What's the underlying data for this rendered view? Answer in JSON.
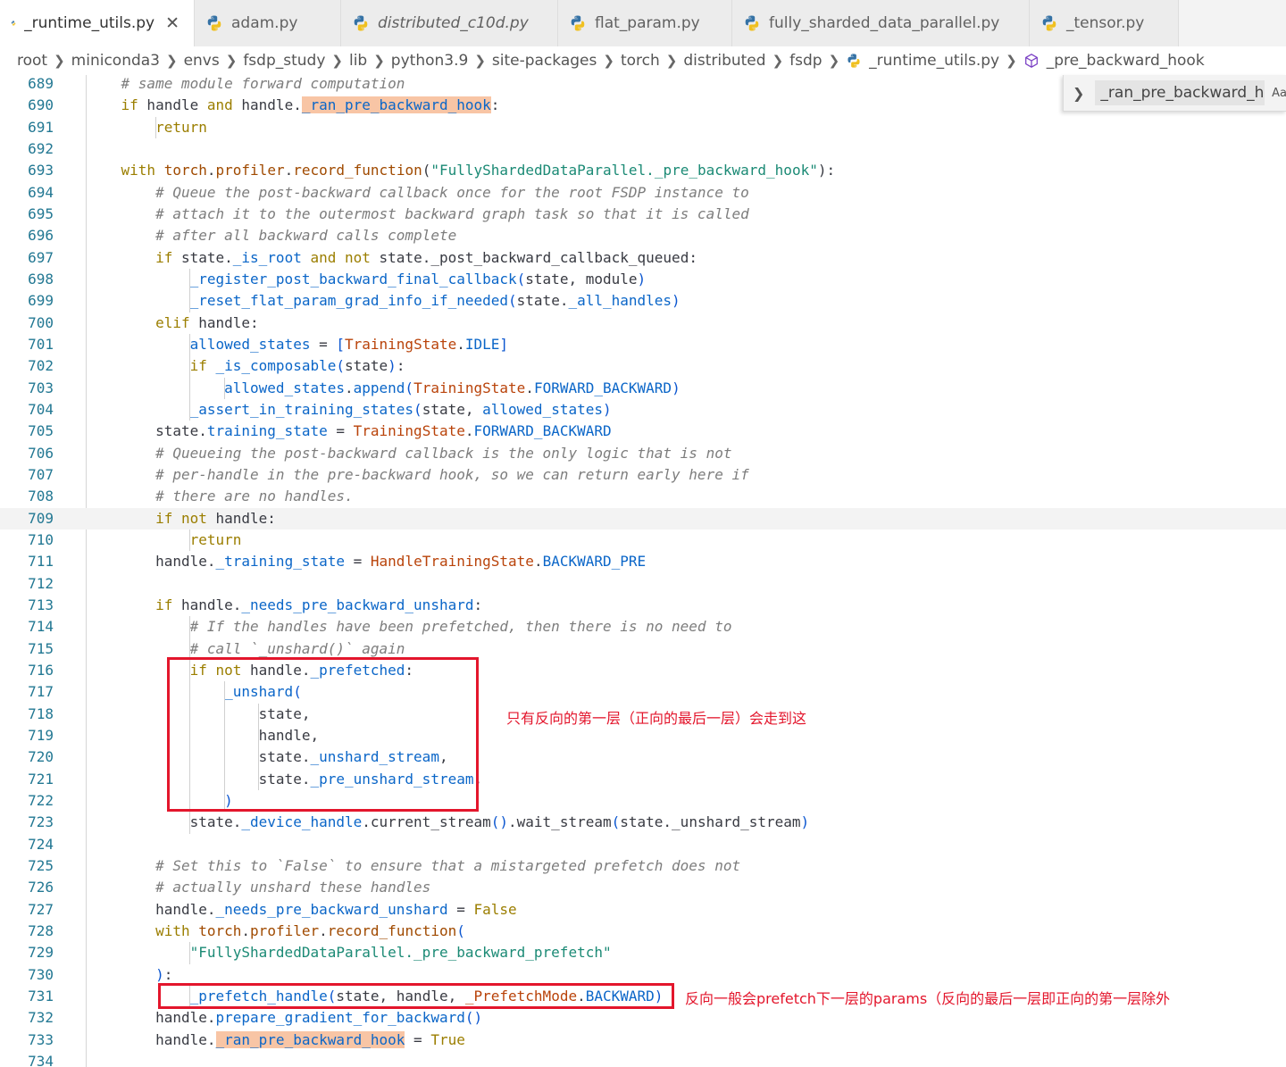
{
  "tabs": [
    {
      "label": "_runtime_utils.py",
      "active": true,
      "italic": false,
      "closable": true
    },
    {
      "label": "adam.py",
      "active": false,
      "italic": false
    },
    {
      "label": "distributed_c10d.py",
      "active": false,
      "italic": true
    },
    {
      "label": "flat_param.py",
      "active": false,
      "italic": false
    },
    {
      "label": "fully_sharded_data_parallel.py",
      "active": false,
      "italic": false
    },
    {
      "label": "_tensor.py",
      "active": false,
      "italic": false
    }
  ],
  "breadcrumb": [
    "root",
    "miniconda3",
    "envs",
    "fsdp_study",
    "lib",
    "python3.9",
    "site-packages",
    "torch",
    "distributed",
    "fsdp",
    "_runtime_utils.py",
    "_pre_backward_hook"
  ],
  "find_widget": {
    "value": "_ran_pre_backward_h",
    "option_label": "Aa"
  },
  "annotations": {
    "first": "只有反向的第一层（正向的最后一层）会走到这",
    "second": "反向一般会prefetch下一层的params（反向的最后一层即正向的第一层除外"
  },
  "colors": {
    "annotation": "#e3162c",
    "line_number": "#237893",
    "highlight": "#f8c5a5"
  },
  "lines": [
    {
      "n": "689",
      "t": "    <span class='cm'># same module forward computation</span>"
    },
    {
      "n": "690",
      "t": "    <span class='kw'>if</span> handle <span class='kw'>and</span> handle.<span class='attr hl'>_ran_pre_backward_hook</span>:"
    },
    {
      "n": "691",
      "t": "        <span class='kw'>return</span>"
    },
    {
      "n": "692",
      "t": ""
    },
    {
      "n": "693",
      "t": "    <span class='kw'>with</span> <span class='fn'>torch</span>.<span class='fn'>profiler</span>.<span class='fn'>record_function</span>(<span class='str'>\"FullyShardedDataParallel._pre_backward_hook\"</span>):"
    },
    {
      "n": "694",
      "t": "        <span class='cm'># Queue the post-backward callback once for the root FSDP instance to</span>"
    },
    {
      "n": "695",
      "t": "        <span class='cm'># attach it to the outermost backward graph task so that it is called</span>"
    },
    {
      "n": "696",
      "t": "        <span class='cm'># after all backward calls complete</span>"
    },
    {
      "n": "697",
      "t": "        <span class='kw'>if</span> state.<span class='attr'>_is_root</span> <span class='kw'>and not</span> state._post_backward_callback_queued:"
    },
    {
      "n": "698",
      "t": "            <span class='attr'>_register_post_backward_final_callback</span><span class='pn'>(</span>state, module<span class='pn'>)</span>"
    },
    {
      "n": "699",
      "t": "            <span class='attr'>_reset_flat_param_grad_info_if_needed</span><span class='pn'>(</span>state.<span class='attr'>_all_handles</span><span class='pn'>)</span>"
    },
    {
      "n": "700",
      "t": "        <span class='kw'>elif</span> handle:"
    },
    {
      "n": "701",
      "t": "            <span class='attr'>allowed_states</span> = <span class='pn'>[</span><span class='cls'>TrainingState</span>.<span class='attr'>IDLE</span><span class='pn'>]</span>"
    },
    {
      "n": "702",
      "t": "            <span class='kw'>if</span> <span class='attr'>_is_composable</span><span class='pn'>(</span>state<span class='pn'>)</span>:"
    },
    {
      "n": "703",
      "t": "                <span class='attr'>allowed_states</span>.<span class='attr'>append</span><span class='pn'>(</span><span class='cls'>TrainingState</span>.<span class='attr'>FORWARD_BACKWARD</span><span class='pn'>)</span>"
    },
    {
      "n": "704",
      "t": "            <span class='attr'>_assert_in_training_states</span><span class='pn'>(</span>state, <span class='attr'>allowed_states</span><span class='pn'>)</span>"
    },
    {
      "n": "705",
      "t": "        state.<span class='attr'>training_state</span> = <span class='cls'>TrainingState</span>.<span class='attr'>FORWARD_BACKWARD</span>"
    },
    {
      "n": "706",
      "t": "        <span class='cm'># Queueing the post-backward callback is the only logic that is not</span>"
    },
    {
      "n": "707",
      "t": "        <span class='cm'># per-handle in the pre-backward hook, so we can return early here if</span>"
    },
    {
      "n": "708",
      "t": "        <span class='cm'># there are no handles.</span>"
    },
    {
      "n": "709",
      "t": "        <span class='kw'>if not</span> handle:"
    },
    {
      "n": "710",
      "t": "            <span class='kw'>return</span>"
    },
    {
      "n": "711",
      "t": "        handle.<span class='attr'>_training_state</span> = <span class='cls'>HandleTrainingState</span>.<span class='attr'>BACKWARD_PRE</span>"
    },
    {
      "n": "712",
      "t": ""
    },
    {
      "n": "713",
      "t": "        <span class='kw'>if</span> handle.<span class='attr'>_needs_pre_backward_unshard</span>:"
    },
    {
      "n": "714",
      "t": "            <span class='cm'># If the handles have been prefetched, then there is no need to</span>"
    },
    {
      "n": "715",
      "t": "            <span class='cm'># call `_unshard()` again</span>"
    },
    {
      "n": "716",
      "t": "            <span class='kw'>if not</span> handle.<span class='attr'>_prefetched</span>:"
    },
    {
      "n": "717",
      "t": "                <span class='attr'>_unshard</span><span class='pn'>(</span>"
    },
    {
      "n": "718",
      "t": "                    state,"
    },
    {
      "n": "719",
      "t": "                    handle,"
    },
    {
      "n": "720",
      "t": "                    state.<span class='attr'>_unshard_stream</span>,"
    },
    {
      "n": "721",
      "t": "                    state.<span class='attr'>_pre_unshard_stream</span>,"
    },
    {
      "n": "722",
      "t": "                <span class='pn'>)</span>"
    },
    {
      "n": "723",
      "t": "            state.<span class='attr'>_device_handle</span>.current_stream<span class='pn'>()</span>.wait_stream<span class='pn'>(</span>state._unshard_stream<span class='pn'>)</span>"
    },
    {
      "n": "724",
      "t": ""
    },
    {
      "n": "725",
      "t": "        <span class='cm'># Set this to `False` to ensure that a mistargeted prefetch does not</span>"
    },
    {
      "n": "726",
      "t": "        <span class='cm'># actually unshard these handles</span>"
    },
    {
      "n": "727",
      "t": "        handle.<span class='attr'>_needs_pre_backward_unshard</span> = <span class='kw'>False</span>"
    },
    {
      "n": "728",
      "t": "        <span class='kw'>with</span> <span class='fn'>torch</span>.<span class='fn'>profiler</span>.<span class='fn'>record_function</span><span class='pn'>(</span>"
    },
    {
      "n": "729",
      "t": "            <span class='str'>\"FullyShardedDataParallel._pre_backward_prefetch\"</span>"
    },
    {
      "n": "730",
      "t": "        <span class='pn'>)</span>:"
    },
    {
      "n": "731",
      "t": "            <span class='attr'>_prefetch_handle</span><span class='pn'>(</span>state, handle, <span class='cls'>_PrefetchMode</span>.<span class='attr'>BACKWARD</span><span class='pn'>)</span>"
    },
    {
      "n": "732",
      "t": "        handle.<span class='attr'>prepare_gradient_for_backward</span><span class='pn'>()</span>"
    },
    {
      "n": "733",
      "t": "        handle.<span class='attr hl'>_ran_pre_backward_hook</span> = <span class='kw'>True</span>"
    },
    {
      "n": "734",
      "t": ""
    }
  ]
}
